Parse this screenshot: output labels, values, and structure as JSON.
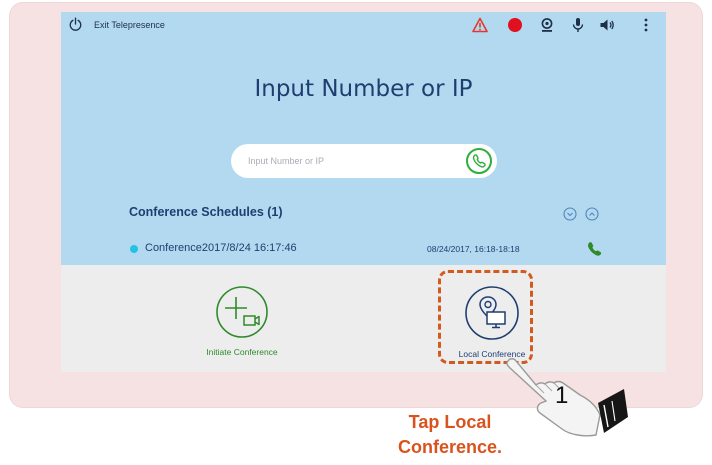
{
  "topbar": {
    "exit_label": "Exit Telepresence",
    "icons": [
      "power-icon",
      "warning-icon",
      "record-icon",
      "camera-icon",
      "microphone-icon",
      "speaker-icon",
      "more-vert-icon"
    ]
  },
  "main": {
    "title": "Input Number or IP",
    "search": {
      "placeholder": "Input Number or IP",
      "value": ""
    }
  },
  "schedules": {
    "title": "Conference Schedules (1)",
    "items": [
      {
        "name": "Conference2017/8/24 16:17:46",
        "time": "08/24/2017, 16:18-18:18"
      }
    ]
  },
  "actions": {
    "initiate_label": "Initiate Conference",
    "local_label": "Local Conference"
  },
  "annotation": {
    "step": "1",
    "caption_line1": "Tap Local",
    "caption_line2": "Conference."
  },
  "colors": {
    "accent_blue": "#1f3e70",
    "panel_blue": "#b3d9f1",
    "green": "#2f8a2a",
    "highlight": "#d25a1e",
    "warning": "#e23a2a",
    "record": "#e0101e"
  }
}
